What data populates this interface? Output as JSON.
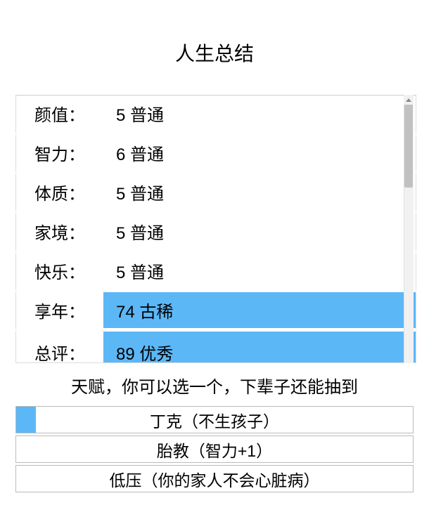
{
  "title": "人生总结",
  "stats": [
    {
      "label": "颜值：",
      "valueText": "5 普通",
      "highlighted": false
    },
    {
      "label": "智力：",
      "valueText": "6 普通",
      "highlighted": false
    },
    {
      "label": "体质：",
      "valueText": "5 普通",
      "highlighted": false
    },
    {
      "label": "家境：",
      "valueText": "5 普通",
      "highlighted": false
    },
    {
      "label": "快乐：",
      "valueText": "5 普通",
      "highlighted": false
    },
    {
      "label": "享年：",
      "valueText": "74 古稀",
      "highlighted": true
    },
    {
      "label": "总评：",
      "valueText": "89 优秀",
      "highlighted": true
    }
  ],
  "talent": {
    "header": "天赋，你可以选一个，下辈子还能抽到",
    "items": [
      {
        "text": "丁克（不生孩子）",
        "selected": true
      },
      {
        "text": "胎教（智力+1）",
        "selected": false
      },
      {
        "text": "低压（你的家人不会心脏病）",
        "selected": false
      }
    ]
  }
}
